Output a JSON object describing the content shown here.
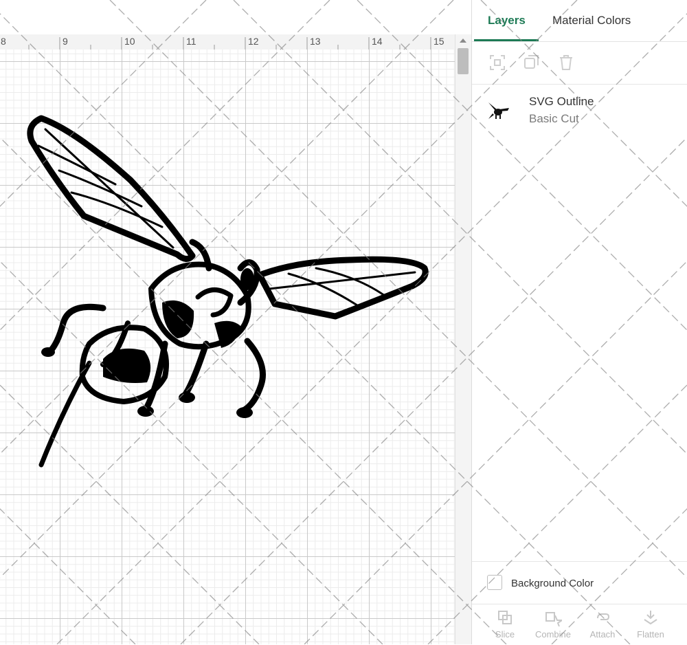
{
  "ruler": {
    "labels": [
      "8",
      "9",
      "10",
      "11",
      "12",
      "13",
      "14",
      "15"
    ]
  },
  "panel": {
    "tabs": [
      {
        "label": "Layers",
        "active": true
      },
      {
        "label": "Material Colors",
        "active": false
      }
    ],
    "toolbar": {
      "icons": [
        "group-icon",
        "duplicate-icon",
        "delete-icon"
      ]
    },
    "layer": {
      "name": "SVG Outline",
      "operation": "Basic Cut"
    },
    "background_color_label": "Background Color",
    "bottom_actions": [
      {
        "label": "Slice",
        "icon": "slice-icon"
      },
      {
        "label": "Combine",
        "icon": "combine-icon"
      },
      {
        "label": "Attach",
        "icon": "attach-icon"
      },
      {
        "label": "Flatten",
        "icon": "flatten-icon"
      }
    ]
  },
  "colors": {
    "accent": "#1d7a55",
    "grid_major": "#c9c9c9",
    "grid_minor": "#ececec"
  }
}
